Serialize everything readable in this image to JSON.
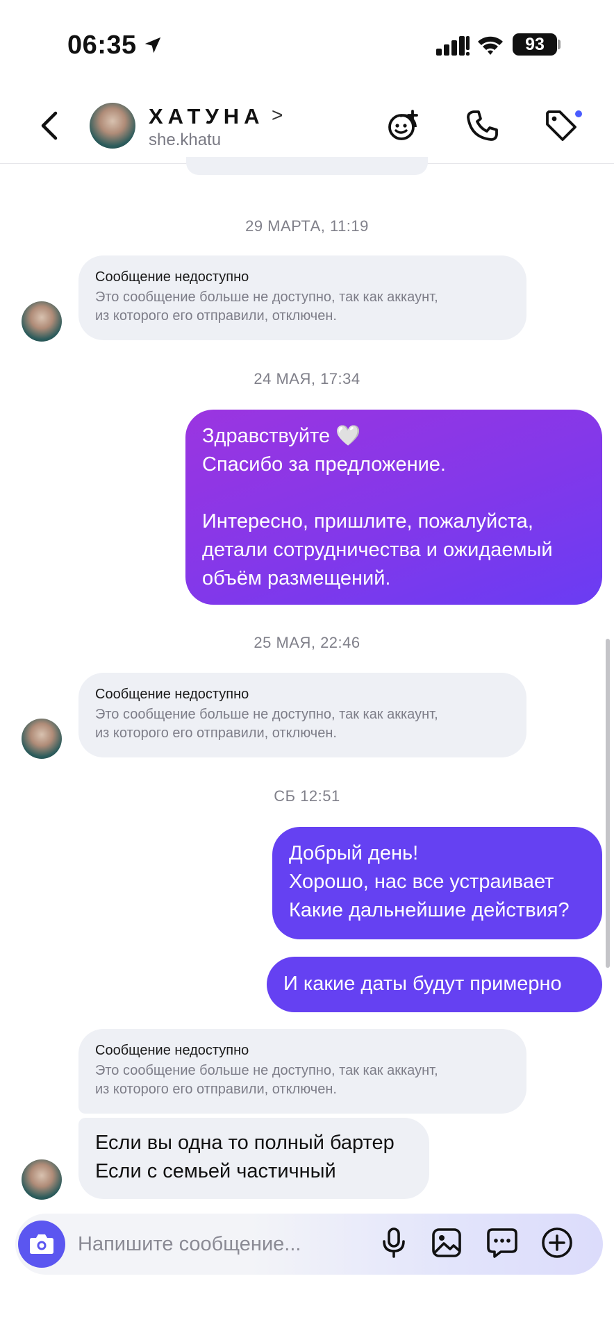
{
  "status_bar": {
    "time": "06:35",
    "battery": "93"
  },
  "header": {
    "name": "ХАТУНА",
    "name_chevron": ">",
    "handle": "she.khatu"
  },
  "messages": {
    "date_1": "29 МАРТА, 11:19",
    "date_2": "24 МАЯ, 17:34",
    "date_3": "25 МАЯ, 22:46",
    "date_4": "СБ 12:51",
    "unavailable_title": "Сообщение недоступно",
    "unavailable_body_1": "Это сообщение больше не доступно, так как аккаунт,",
    "unavailable_body_2": "из которого его отправили, отключен.",
    "out_1_lines": [
      "Здравствуйте 🤍",
      "Спасибо за предложение.",
      "",
      "Интересно, пришлите, пожалуйста,",
      "детали сотрудничества и ожидаемый",
      "объём размещений."
    ],
    "out_2_lines": [
      "Добрый день!",
      "Хорошо, нас все устраивает",
      "Какие дальнейшие действия?"
    ],
    "out_3": "И какие даты будут примерно",
    "in_1_lines": [
      "Если вы одна то полный бартер",
      "Если с семьей частичный"
    ]
  },
  "composer": {
    "placeholder": "Напишите сообщение..."
  },
  "colors": {
    "accent": "#5b56f0",
    "bubble_out_start": "#9b35e0",
    "bubble_out_end": "#6a3cf3",
    "bubble_out_solid": "#6541f2",
    "bubble_in": "#eef0f5",
    "badge_dot": "#4a5cff"
  },
  "icons": [
    "location-arrow-icon",
    "cellular-signal-icon",
    "wifi-icon",
    "back-chevron-icon",
    "sticker-add-icon",
    "phone-icon",
    "tag-icon",
    "camera-icon",
    "microphone-icon",
    "gallery-icon",
    "chat-bubble-icon",
    "plus-circle-icon"
  ]
}
